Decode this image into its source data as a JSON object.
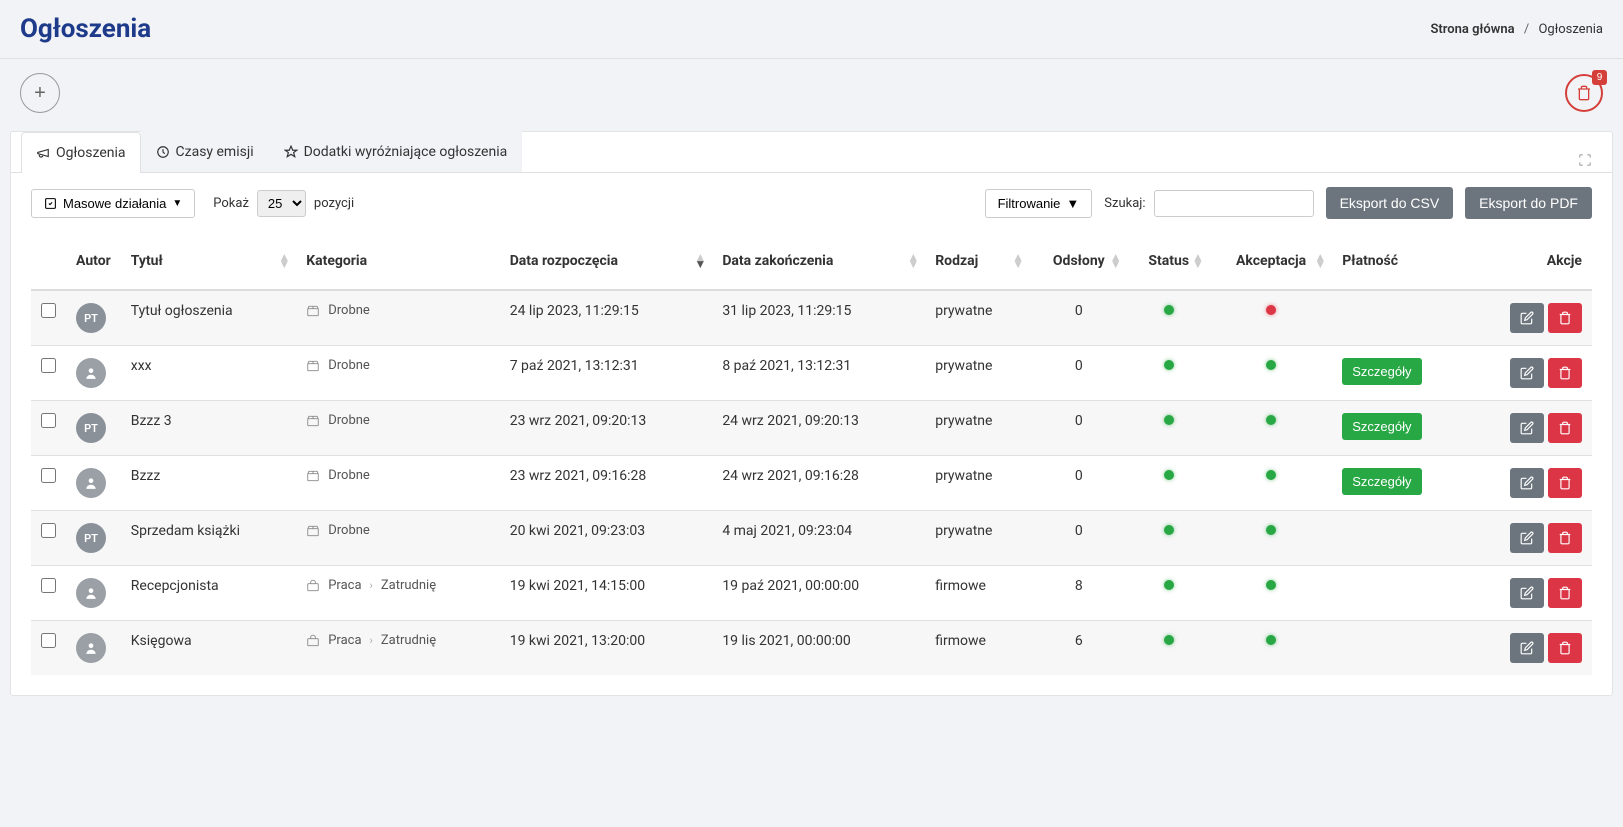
{
  "header": {
    "title": "Ogłoszenia",
    "breadcrumb_home": "Strona główna",
    "breadcrumb_current": "Ogłoszenia"
  },
  "trash_count": "9",
  "tabs": [
    {
      "label": "Ogłoszenia",
      "active": true,
      "icon": "megaphone"
    },
    {
      "label": "Czasy emisji",
      "active": false,
      "icon": "clock"
    },
    {
      "label": "Dodatki wyróżniające ogłoszenia",
      "active": false,
      "icon": "star"
    }
  ],
  "toolbar": {
    "mass_actions": "Masowe działania",
    "show_label": "Pokaż",
    "page_size": "25",
    "positions_label": "pozycji",
    "filter": "Filtrowanie",
    "search_label": "Szukaj:",
    "export_csv": "Eksport do CSV",
    "export_pdf": "Eksport do PDF"
  },
  "columns": {
    "author": "Autor",
    "title": "Tytuł",
    "category": "Kategoria",
    "date_start": "Data rozpoczęcia",
    "date_end": "Data zakończenia",
    "kind": "Rodzaj",
    "views": "Odsłony",
    "status": "Status",
    "acceptance": "Akceptacja",
    "payment": "Płatność",
    "actions": "Akcje"
  },
  "details_label": "Szczegóły",
  "rows": [
    {
      "avatar": "PT",
      "avatar_type": "pt",
      "title": "Tytuł ogłoszenia",
      "category": [
        "Drobne"
      ],
      "cat_icon": "box",
      "date_start": "24 lip 2023, 11:29:15",
      "date_end": "31 lip 2023, 11:29:15",
      "kind": "prywatne",
      "views": "0",
      "status": "green",
      "acceptance": "red",
      "payment": false
    },
    {
      "avatar": "user",
      "avatar_type": "icon",
      "title": "xxx",
      "category": [
        "Drobne"
      ],
      "cat_icon": "box",
      "date_start": "7 paź 2021, 13:12:31",
      "date_end": "8 paź 2021, 13:12:31",
      "kind": "prywatne",
      "views": "0",
      "status": "green",
      "acceptance": "green",
      "payment": true
    },
    {
      "avatar": "PT",
      "avatar_type": "pt",
      "title": "Bzzz 3",
      "category": [
        "Drobne"
      ],
      "cat_icon": "box",
      "date_start": "23 wrz 2021, 09:20:13",
      "date_end": "24 wrz 2021, 09:20:13",
      "kind": "prywatne",
      "views": "0",
      "status": "green",
      "acceptance": "green",
      "payment": true
    },
    {
      "avatar": "user",
      "avatar_type": "icon",
      "title": "Bzzz",
      "category": [
        "Drobne"
      ],
      "cat_icon": "box",
      "date_start": "23 wrz 2021, 09:16:28",
      "date_end": "24 wrz 2021, 09:16:28",
      "kind": "prywatne",
      "views": "0",
      "status": "green",
      "acceptance": "green",
      "payment": true
    },
    {
      "avatar": "PT",
      "avatar_type": "pt",
      "title": "Sprzedam książki",
      "category": [
        "Drobne"
      ],
      "cat_icon": "box",
      "date_start": "20 kwi 2021, 09:23:03",
      "date_end": "4 maj 2021, 09:23:04",
      "kind": "prywatne",
      "views": "0",
      "status": "green",
      "acceptance": "green",
      "payment": false
    },
    {
      "avatar": "user",
      "avatar_type": "icon",
      "title": "Recepcjonista",
      "category": [
        "Praca",
        "Zatrudnię"
      ],
      "cat_icon": "bag",
      "date_start": "19 kwi 2021, 14:15:00",
      "date_end": "19 paź 2021, 00:00:00",
      "kind": "firmowe",
      "views": "8",
      "status": "green",
      "acceptance": "green",
      "payment": false
    },
    {
      "avatar": "user",
      "avatar_type": "icon",
      "title": "Księgowa",
      "category": [
        "Praca",
        "Zatrudnię"
      ],
      "cat_icon": "bag",
      "date_start": "19 kwi 2021, 13:20:00",
      "date_end": "19 lis 2021, 00:00:00",
      "kind": "firmowe",
      "views": "6",
      "status": "green",
      "acceptance": "green",
      "payment": false
    }
  ]
}
